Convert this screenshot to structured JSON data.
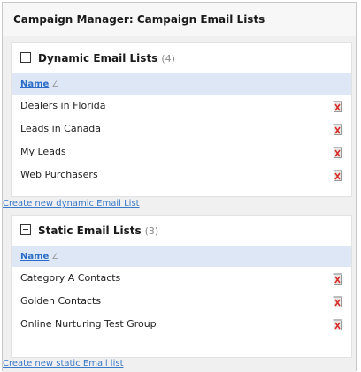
{
  "title": "Campaign Manager: Campaign Email Lists",
  "dynamic": {
    "heading": "Dynamic Email Lists",
    "count": "(4)",
    "column_header": "Name",
    "items": [
      "Dealers in Florida",
      "Leads in Canada",
      "My Leads",
      "Web Purchasers"
    ],
    "create_link": "Create new dynamic Email List"
  },
  "static": {
    "heading": "Static Email Lists",
    "count": "(3)",
    "column_header": "Name",
    "items": [
      "Category A Contacts",
      "Golden Contacts",
      "Online Nurturing Test Group"
    ],
    "create_link": "Create new static Email list"
  },
  "icons": {
    "toggle": "collapse-minus-icon",
    "sort": "sort-arrow-icon",
    "delete": "trash-delete-icon"
  },
  "colors": {
    "header_blue": "#dde7f5",
    "link_blue": "#2a6cc7",
    "delete_red": "#d9302a"
  }
}
